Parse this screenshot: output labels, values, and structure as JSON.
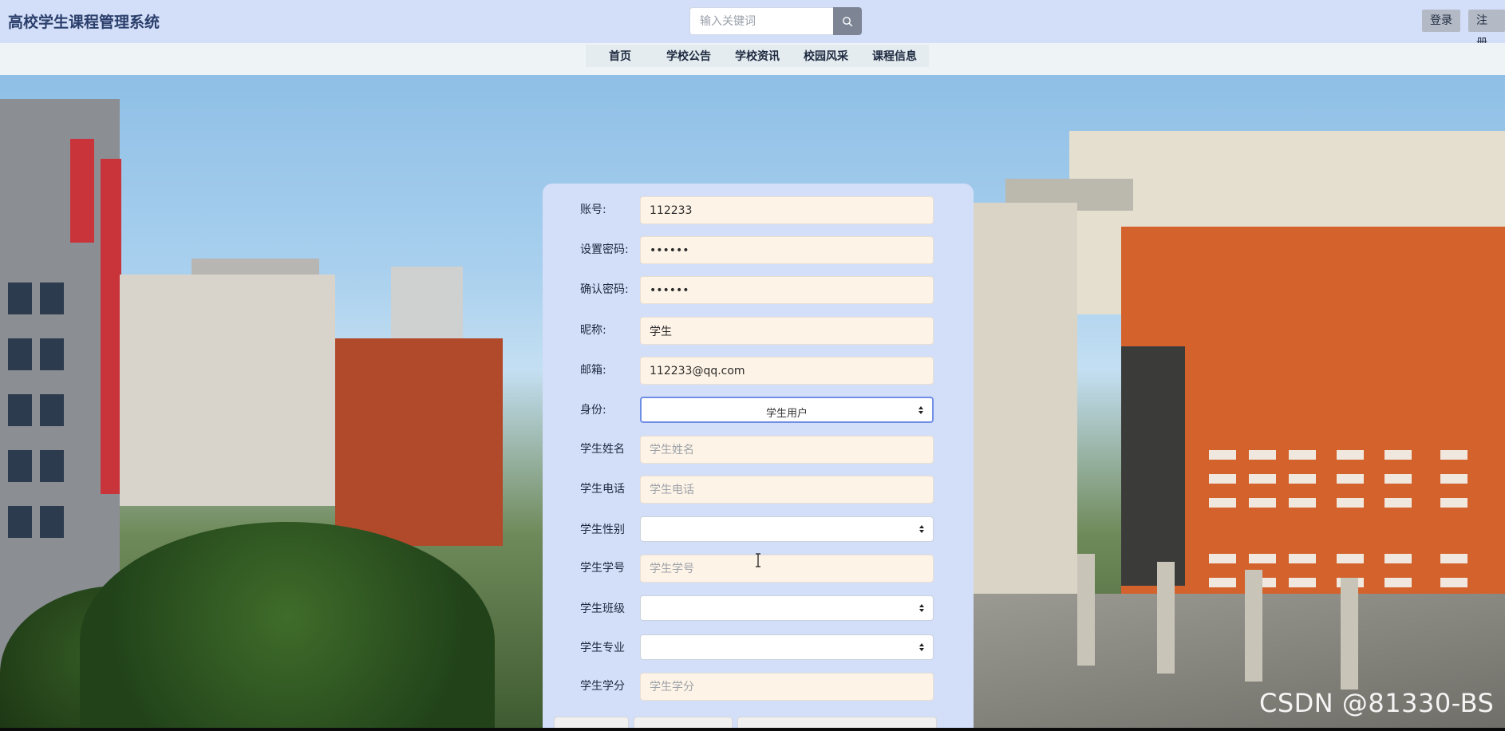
{
  "header": {
    "title": "高校学生课程管理系统",
    "search_placeholder": "输入关键词",
    "login_label": "登录",
    "register_label": "注册"
  },
  "nav": {
    "items": [
      "首页",
      "学校公告",
      "学校资讯",
      "校园风采",
      "课程信息"
    ]
  },
  "form": {
    "account": {
      "label": "账号:",
      "value": "112233"
    },
    "password": {
      "label": "设置密码:",
      "value": "••••••"
    },
    "confirm_password": {
      "label": "确认密码:",
      "value": "••••••"
    },
    "nickname": {
      "label": "昵称:",
      "value": "学生"
    },
    "email": {
      "label": "邮箱:",
      "value": "112233@qq.com"
    },
    "identity": {
      "label": "身份:",
      "value": "学生用户"
    },
    "student_name": {
      "label": "学生姓名",
      "placeholder": "学生姓名"
    },
    "student_phone": {
      "label": "学生电话",
      "placeholder": "学生电话"
    },
    "student_gender": {
      "label": "学生性别",
      "value": ""
    },
    "student_id": {
      "label": "学生学号",
      "placeholder": "学生学号"
    },
    "student_class": {
      "label": "学生班级",
      "value": ""
    },
    "student_major": {
      "label": "学生专业",
      "value": ""
    },
    "student_credit": {
      "label": "学生学分",
      "placeholder": "学生学分"
    }
  },
  "watermark": "CSDN @81330-BS",
  "colors": {
    "header_bg": "#d3def8",
    "panel_bg": "#d3def8",
    "field_bg": "#fdf3e6",
    "focus_border": "#6f8ee6"
  }
}
